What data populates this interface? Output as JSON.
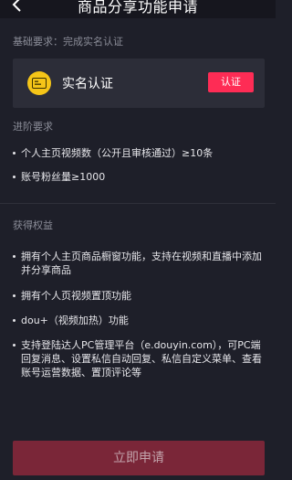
{
  "header": {
    "title": "商品分享功能申请"
  },
  "basic": {
    "label": "基础要求：完成实名认证",
    "card_title": "实名认证",
    "button_label": "认证"
  },
  "advanced": {
    "label": "进阶要求",
    "items": [
      "个人主页视频数（公开且审核通过）≥10条",
      "账号粉丝量≥1000"
    ]
  },
  "benefits": {
    "label": "获得权益",
    "items": [
      "拥有个人主页商品橱窗功能，支持在视频和直播中添加并分享商品",
      "拥有个人页视频置顶功能",
      "dou+（视频加热）功能",
      "支持登陆达人PC管理平台（e.douyin.com），可PC端回复消息、设置私信自动回复、私信自定义菜单、查看账号运营数据、置顶评论等"
    ]
  },
  "footer": {
    "submit_label": "立即申请"
  }
}
